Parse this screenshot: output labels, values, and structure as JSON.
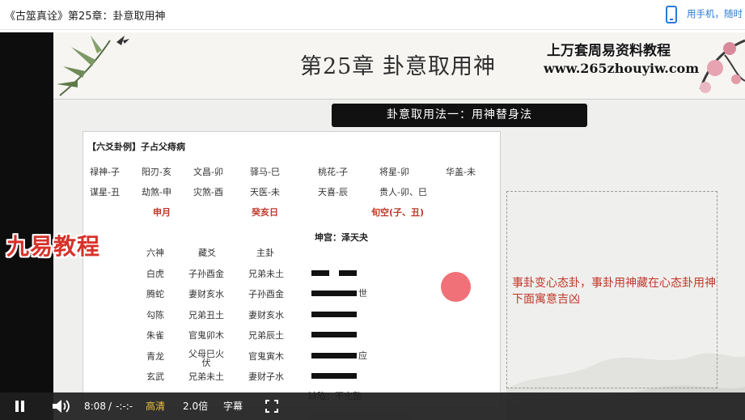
{
  "page": {
    "title": "《古筮真诠》第25章：卦意取用神",
    "mobile_link": "用手机，随时"
  },
  "slide": {
    "chapter_title": "第25章 卦意取用神",
    "site_line1": "上万套周易资料教程",
    "site_line2": "www.265zhouyiw.com",
    "method_banner": "卦意取用法一：用神替身法",
    "watermark": "九易教程",
    "note": "事卦变心态卦，事卦用神藏在心态卦用神下面寓意吉凶",
    "card": {
      "header": "【六爻卦例】子占父痔病",
      "shensha_row1": [
        "禄神-子",
        "阳刃-亥",
        "文昌-卯",
        "驿马-巳",
        "桃花-子",
        "将星-卯",
        "华盖-未"
      ],
      "shensha_row2": [
        "谋星-丑",
        "劫煞-申",
        "灾煞-酉",
        "天医-未",
        "天喜-辰",
        "贵人-卯、巳"
      ],
      "month": "申月",
      "day": "癸亥日",
      "xunkong": "旬空(子、丑)",
      "gong": "坤宫：泽天夬",
      "col_headers": [
        "六神",
        "藏爻",
        "主卦"
      ],
      "rows": [
        {
          "liushen": "白虎",
          "cang": "子孙酉金",
          "zhu": "兄弟未土",
          "yao_type": "yin",
          "mark": ""
        },
        {
          "liushen": "腾蛇",
          "cang": "妻财亥水",
          "zhu": "子孙酉金",
          "yao_type": "yang",
          "mark": "世"
        },
        {
          "liushen": "勾陈",
          "cang": "兄弟丑土",
          "zhu": "妻财亥水",
          "yao_type": "yang",
          "mark": ""
        },
        {
          "liushen": "朱雀",
          "cang": "官鬼卯木",
          "zhu": "兄弟辰土",
          "yao_type": "yang",
          "mark": ""
        },
        {
          "liushen": "青龙",
          "cang": "父母巳火\n伏",
          "zhu": "官鬼寅木",
          "yao_type": "yang",
          "mark": "应"
        },
        {
          "liushen": "玄武",
          "cang": "兄弟未土",
          "zhu": "妻财子水",
          "yao_type": "yang",
          "mark": ""
        }
      ],
      "footer": "缺陷：不完整"
    }
  },
  "controls": {
    "time": "8:08",
    "separator": "/",
    "duration": "-:-:-",
    "quality": "高清",
    "speed": "2.0倍",
    "subtitles": "字幕"
  },
  "colors": {
    "accent_red": "#c0392b",
    "link_blue": "#2a7ad6",
    "quality_gold": "#f0c43c"
  }
}
